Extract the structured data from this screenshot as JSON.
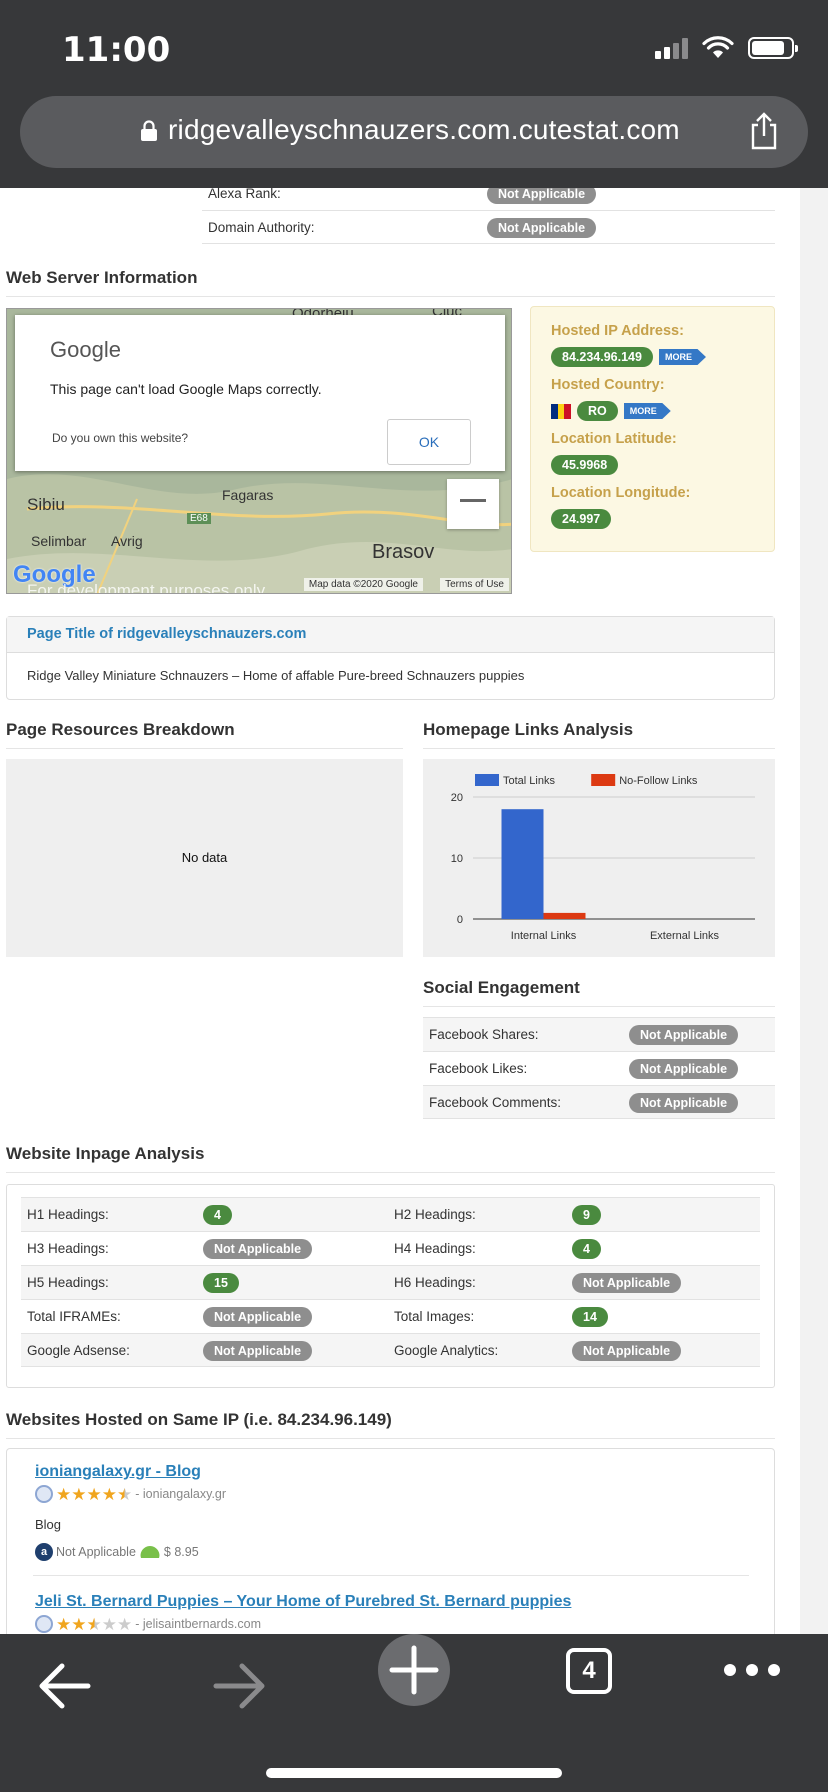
{
  "status_bar": {
    "time": "11:00"
  },
  "url_bar": {
    "url": "ridgevalleyschnauzers.com.cutestat.com"
  },
  "top_rows": [
    {
      "label": "Alexa Rank:",
      "value": "Not Applicable"
    },
    {
      "label": "Domain Authority:",
      "value": "Not Applicable"
    }
  ],
  "web_server": {
    "title": "Web Server Information",
    "map": {
      "towns": [
        "Odorheiu",
        "Ciuc",
        "Sibiu",
        "Selimbar",
        "Avrig",
        "Fagaras",
        "E68",
        "Brasov"
      ],
      "dialog_logo": "Google",
      "dialog_message": "This page can't load Google Maps correctly.",
      "dialog_question": "Do you own this website?",
      "dialog_ok": "OK",
      "zoom_out": "−",
      "attribution": "Map data ©2020 Google",
      "terms": "Terms of Use",
      "watermark": "For development purposes only",
      "google_logo": "Google"
    },
    "hosted_ip_label": "Hosted IP Address:",
    "hosted_ip": "84.234.96.149",
    "more_label": "MORE",
    "hosted_country_label": "Hosted Country:",
    "hosted_country": "RO",
    "latitude_label": "Location Latitude:",
    "latitude": "45.9968",
    "longitude_label": "Location Longitude:",
    "longitude": "24.997"
  },
  "page_title_panel": {
    "heading": "Page Title of ridgevalleyschnauzers.com",
    "text": "Ridge Valley Miniature Schnauzers – Home of affable Pure-breed Schnauzers puppies"
  },
  "resources": {
    "title": "Page Resources Breakdown",
    "no_data": "No data"
  },
  "links_analysis": {
    "title": "Homepage Links Analysis"
  },
  "chart_data": {
    "type": "bar",
    "categories": [
      "Internal Links",
      "External Links"
    ],
    "series": [
      {
        "name": "Total Links",
        "values": [
          18,
          0
        ]
      },
      {
        "name": "No-Follow Links",
        "values": [
          1,
          0
        ]
      }
    ],
    "colors": [
      "#3366cc",
      "#dc3912"
    ],
    "ylim": [
      0,
      20
    ],
    "yticks": [
      "0",
      "10",
      "20"
    ],
    "legend": "top",
    "grid": true
  },
  "social": {
    "title": "Social Engagement",
    "rows": [
      {
        "label": "Facebook Shares:",
        "value": "Not Applicable"
      },
      {
        "label": "Facebook Likes:",
        "value": "Not Applicable"
      },
      {
        "label": "Facebook Comments:",
        "value": "Not Applicable"
      }
    ]
  },
  "inpage": {
    "title": "Website Inpage Analysis",
    "rows": [
      {
        "l1": "H1 Headings:",
        "v1": "4",
        "l2": "H2 Headings:",
        "v2": "9"
      },
      {
        "l1": "H3 Headings:",
        "v1": "Not Applicable",
        "l2": "H4 Headings:",
        "v2": "4"
      },
      {
        "l1": "H5 Headings:",
        "v1": "15",
        "l2": "H6 Headings:",
        "v2": "Not Applicable"
      },
      {
        "l1": "Total IFRAMEs:",
        "v1": "Not Applicable",
        "l2": "Total Images:",
        "v2": "14"
      },
      {
        "l1": "Google Adsense:",
        "v1": "Not Applicable",
        "l2": "Google Analytics:",
        "v2": "Not Applicable"
      }
    ]
  },
  "same_ip": {
    "title": "Websites Hosted on Same IP (i.e. 84.234.96.149)",
    "sites": [
      {
        "name": "ioniangalaxy.gr - Blog",
        "rating": 4.5,
        "domain": "- ioniangalaxy.gr",
        "description": "Blog",
        "alexa": "Not Applicable",
        "price": "$ 8.95"
      },
      {
        "name": "Jeli St. Bernard Puppies – Your Home of Purebred St. Bernard puppies",
        "rating": 2.5,
        "domain": "- jelisaintbernards.com"
      }
    ]
  },
  "toolbar": {
    "tabs_count": "4"
  },
  "colors": {
    "chrome": "#37383a",
    "link": "#2a80b9",
    "gold": "#c6a14b",
    "green_pill": "#4a8a3f",
    "grey_pill": "#8e8e8e"
  }
}
